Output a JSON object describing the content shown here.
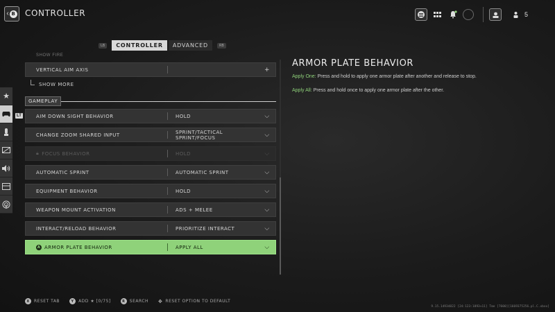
{
  "header": {
    "back_badge": "B",
    "title": "CONTROLLER",
    "player_count": "5"
  },
  "tabs": {
    "lb": "LB",
    "rb": "RB",
    "items": [
      {
        "label": "CONTROLLER",
        "active": true
      },
      {
        "label": "ADVANCED",
        "active": false
      }
    ]
  },
  "sidebar": {
    "badge": "LT",
    "items": [
      {
        "icon": "star-icon"
      },
      {
        "icon": "controller-icon",
        "active": true
      },
      {
        "icon": "gamepad-stick-icon"
      },
      {
        "icon": "display-icon"
      },
      {
        "icon": "speaker-icon"
      },
      {
        "icon": "interface-icon"
      },
      {
        "icon": "network-icon"
      }
    ]
  },
  "list": {
    "cutoff_text": "SHOW FIRE",
    "vertical_aim": {
      "label": "VERTICAL AIM AXIS",
      "control": "+"
    },
    "show_more": "SHOW MORE",
    "section_gameplay": "GAMEPLAY",
    "rows": [
      {
        "label": "AIM DOWN SIGHT BEHAVIOR",
        "value": "HOLD",
        "state": "normal"
      },
      {
        "label": "CHANGE ZOOM SHARED INPUT",
        "value": "SPRINT/TACTICAL SPRINT/FOCUS",
        "state": "normal"
      },
      {
        "label": "FOCUS BEHAVIOR",
        "value": "HOLD",
        "state": "disabled"
      },
      {
        "label": "AUTOMATIC SPRINT",
        "value": "AUTOMATIC SPRINT",
        "state": "normal"
      },
      {
        "label": "EQUIPMENT BEHAVIOR",
        "value": "HOLD",
        "state": "normal"
      },
      {
        "label": "WEAPON MOUNT ACTIVATION",
        "value": "ADS + MELEE",
        "state": "normal"
      },
      {
        "label": "INTERACT/RELOAD BEHAVIOR",
        "value": "PRIORITIZE INTERACT",
        "state": "normal"
      },
      {
        "label": "ARMOR PLATE BEHAVIOR",
        "value": "APPLY ALL",
        "state": "highlight"
      }
    ]
  },
  "detail": {
    "title": "ARMOR PLATE BEHAVIOR",
    "line1_key": "Apply One:",
    "line1_text": " Press and hold to apply one armor plate after another and release to stop.",
    "line2_key": "Apply All:",
    "line2_text": " Press and hold once to apply one armor plate after the other."
  },
  "footer": {
    "reset_tab_btn": "X",
    "reset_tab": "RESET TAB",
    "add_btn": "Y",
    "add": "ADD ★ [0/75]",
    "search_btn": "R",
    "search": "SEARCH",
    "reset_option": "RESET OPTION TO DEFAULT"
  },
  "build_info": "9.15.14934822 [24:123:1893+11] Tme [7600][1669375256.pl.C.xbox]",
  "colors": {
    "highlight": "#8fd27a",
    "background": "#1b1b1b"
  }
}
